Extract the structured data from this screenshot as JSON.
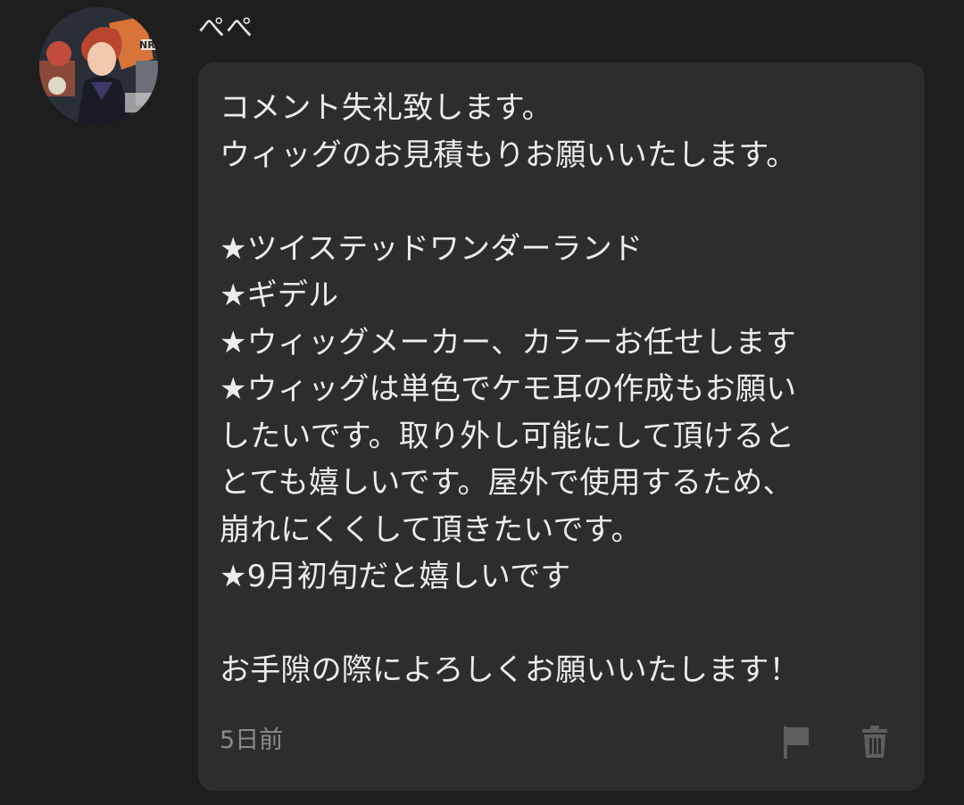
{
  "comment": {
    "author": {
      "name": "ぺぺ",
      "avatar_icon": "user-avatar-image"
    },
    "body": "コメント失礼致します。\nウィッグのお見積もりお願いいたします。\n\n★ツイステッドワンダーランド\n★ギデル\n★ウィッグメーカー、カラーお任せします\n★ウィッグは単色でケモ耳の作成もお願い\nしたいです。取り外し可能にして頂けると\nとても嬉しいです。屋外で使用するため、\n崩れにくくして頂きたいです。\n★9月初旬だと嬉しいです\n\nお手隙の際によろしくお願いいたします！",
    "timestamp": "5日前",
    "actions": [
      {
        "icon": "flag-icon"
      },
      {
        "icon": "trash-icon"
      }
    ]
  },
  "colors": {
    "background": "#1e1e1e",
    "bubble": "#2d2d2d",
    "text": "#ececec",
    "muted": "#8a8a8a",
    "icon": "#5e5e5e"
  }
}
